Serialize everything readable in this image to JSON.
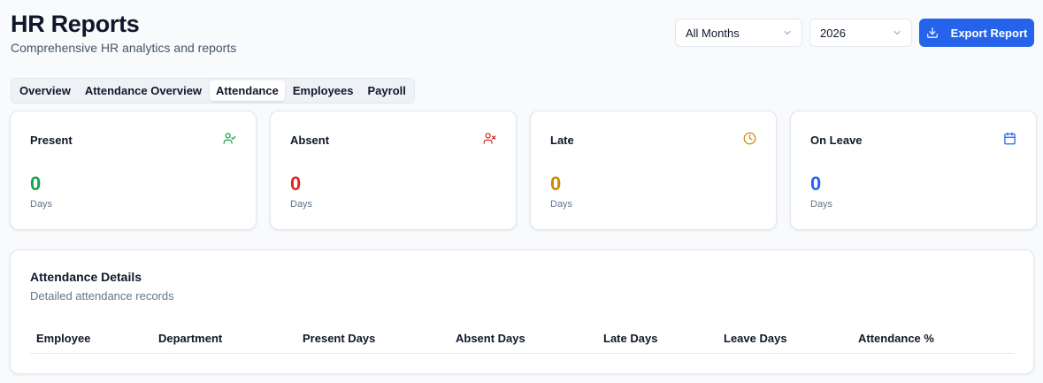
{
  "header": {
    "title": "HR Reports",
    "subtitle": "Comprehensive HR analytics and reports"
  },
  "controls": {
    "month_select": "All Months",
    "year_select": "2026",
    "export_label": "Export Report"
  },
  "tabs": [
    {
      "label": "Overview",
      "active": false
    },
    {
      "label": "Attendance Overview",
      "active": false
    },
    {
      "label": "Attendance",
      "active": true
    },
    {
      "label": "Employees",
      "active": false
    },
    {
      "label": "Payroll",
      "active": false
    }
  ],
  "cards": [
    {
      "label": "Present",
      "value": "0",
      "unit": "Days",
      "color": "#16a34a",
      "icon": "user-check-icon"
    },
    {
      "label": "Absent",
      "value": "0",
      "unit": "Days",
      "color": "#dc2626",
      "icon": "user-x-icon"
    },
    {
      "label": "Late",
      "value": "0",
      "unit": "Days",
      "color": "#ca8a04",
      "icon": "clock-icon"
    },
    {
      "label": "On Leave",
      "value": "0",
      "unit": "Days",
      "color": "#2563eb",
      "icon": "calendar-icon"
    }
  ],
  "details": {
    "title": "Attendance Details",
    "subtitle": "Detailed attendance records",
    "columns": [
      "Employee",
      "Department",
      "Present Days",
      "Absent Days",
      "Late Days",
      "Leave Days",
      "Attendance %"
    ],
    "rows": []
  },
  "colors": {
    "accent": "#2563eb",
    "present": "#16a34a",
    "absent": "#dc2626",
    "late": "#ca8a04",
    "leave": "#2563eb"
  }
}
